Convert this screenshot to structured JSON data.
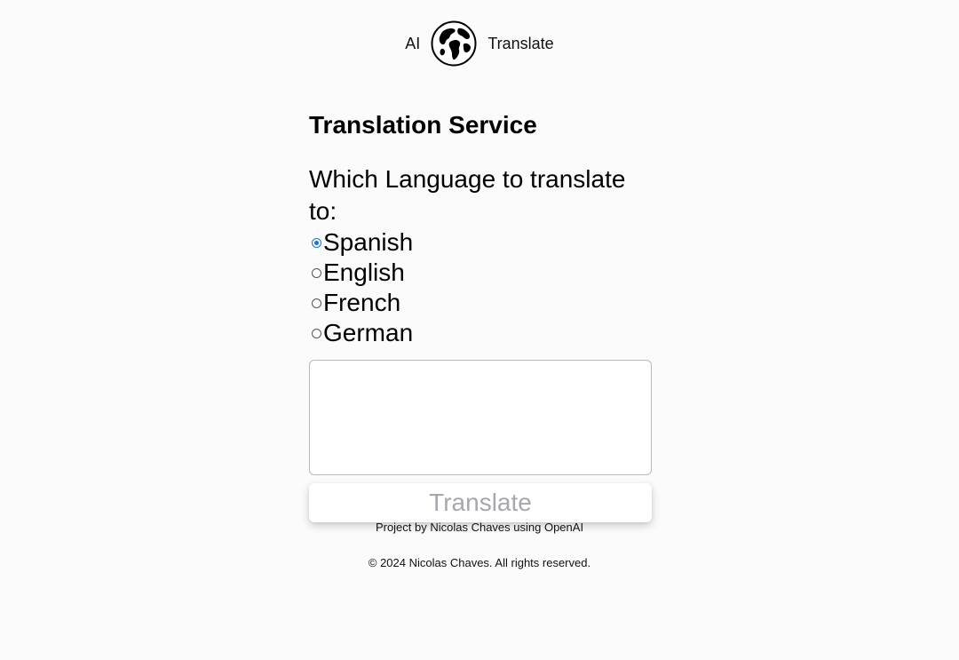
{
  "header": {
    "left_word": "AI",
    "right_word": "Translate",
    "logo_icon": "globe-icon"
  },
  "main": {
    "title": "Translation Service",
    "question": "Which Language to translate to:",
    "languages": [
      {
        "label": "Spanish",
        "checked": true
      },
      {
        "label": "English",
        "checked": false
      },
      {
        "label": "French",
        "checked": false
      },
      {
        "label": "German",
        "checked": false
      }
    ],
    "text_input": {
      "value": "",
      "placeholder": ""
    },
    "translate_button": "Translate"
  },
  "footer": {
    "credit": "Project by Nicolas Chaves using OpenAI",
    "copyright": "© 2024 Nicolas Chaves. All rights reserved."
  },
  "colors": {
    "radio_checked": "#1a73e8",
    "button_text_disabled": "#a7a7ad",
    "background": "#fbfbfb"
  }
}
